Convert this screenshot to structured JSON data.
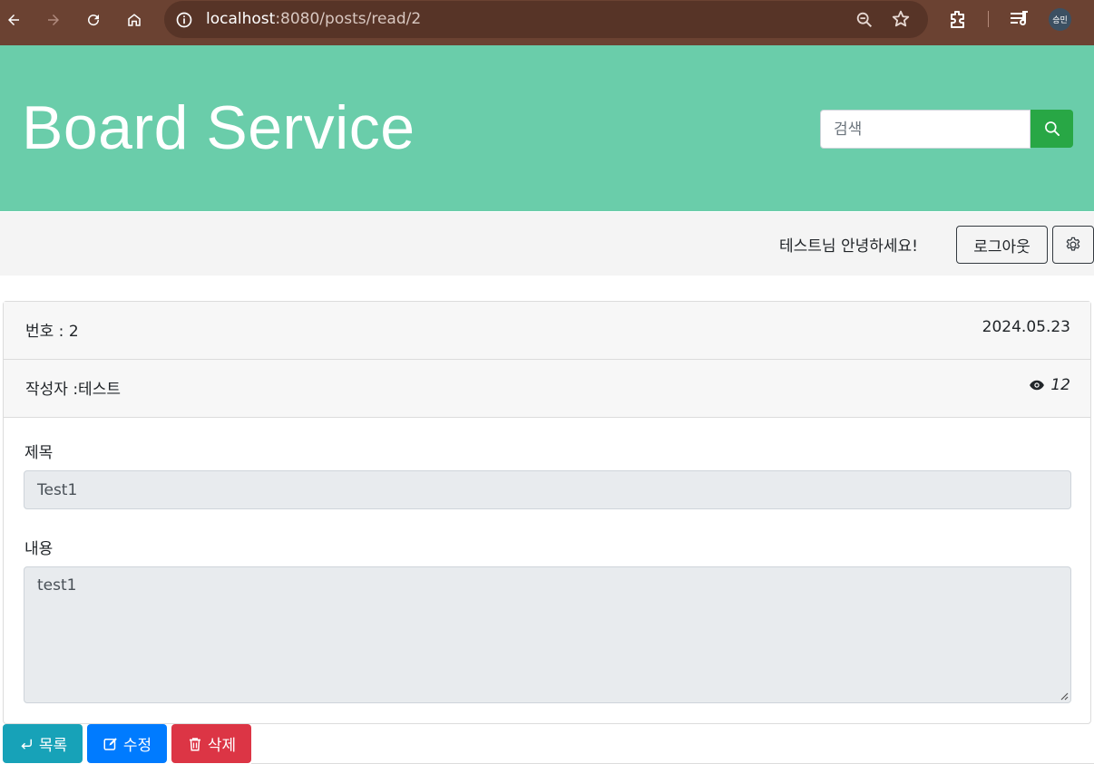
{
  "browser": {
    "url_host": "localhost",
    "url_path": ":8080/posts/read/2",
    "avatar_text": "승민"
  },
  "header": {
    "brand": "Board Service",
    "search_placeholder": "검색"
  },
  "userbar": {
    "greeting": "테스트님 안녕하세요!",
    "logout_label": "로그아웃"
  },
  "post": {
    "number_text": "번호 : 2",
    "date": "2024.05.23",
    "author_text": "작성자 :테스트",
    "views": "12",
    "title_label": "제목",
    "title_value": "Test1",
    "content_label": "내용",
    "content_value": "test1"
  },
  "actions": {
    "list_label": "목록",
    "edit_label": "수정",
    "delete_label": "삭제"
  },
  "colors": {
    "header_bg": "#6acdaa",
    "search_btn": "#28a745",
    "list_btn": "#17a2b8",
    "edit_btn": "#007bff",
    "delete_btn": "#dc3545"
  },
  "icons": [
    "back-icon",
    "forward-icon",
    "reload-icon",
    "home-icon",
    "info-icon",
    "zoom-icon",
    "star-icon",
    "extensions-icon",
    "media-icon",
    "search-icon",
    "gear-icon",
    "eye-icon",
    "return-icon",
    "edit-icon",
    "trash-icon"
  ]
}
